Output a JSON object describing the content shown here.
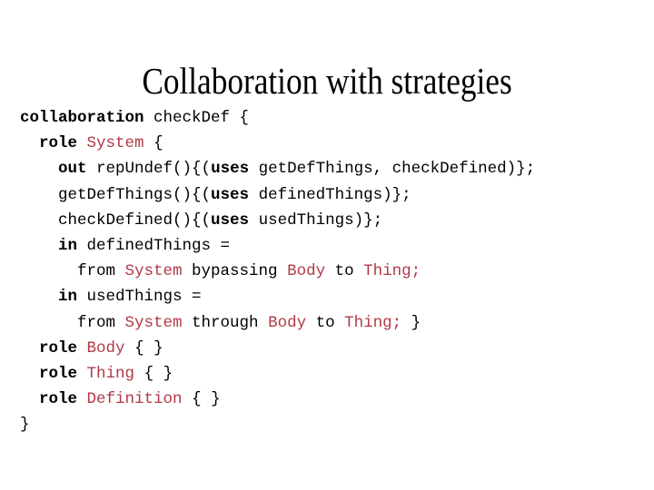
{
  "slide": {
    "title": "Collaboration with strategies",
    "colors": {
      "background": "#ffffff",
      "text": "#000000",
      "role_name": "#b03a48"
    }
  },
  "code": {
    "language": "collaboration-strategy-dsl",
    "lines": [
      {
        "indent": 0,
        "text": "collaboration checkDef {",
        "tokens": [
          {
            "t": "collaboration",
            "style": "kw"
          },
          {
            "t": " ",
            "style": "plain"
          },
          {
            "t": "checkDef {",
            "style": "plain"
          }
        ]
      },
      {
        "indent": 2,
        "text": "  role System {",
        "tokens": [
          {
            "t": "  ",
            "style": "plain"
          },
          {
            "t": "role",
            "style": "kw"
          },
          {
            "t": " ",
            "style": "plain"
          },
          {
            "t": "System",
            "style": "role"
          },
          {
            "t": " {",
            "style": "plain"
          }
        ]
      },
      {
        "indent": 4,
        "text": "    out repUndef(){(uses getDefThings, checkDefined)};",
        "tokens": [
          {
            "t": "    ",
            "style": "plain"
          },
          {
            "t": "out",
            "style": "kw"
          },
          {
            "t": " repUndef(){(",
            "style": "plain"
          },
          {
            "t": "uses",
            "style": "kw"
          },
          {
            "t": " getDefThings, checkDefined)};",
            "style": "plain"
          }
        ]
      },
      {
        "indent": 4,
        "text": "    getDefThings(){(uses definedThings)};",
        "tokens": [
          {
            "t": "    getDefThings(){(",
            "style": "plain"
          },
          {
            "t": "uses",
            "style": "kw"
          },
          {
            "t": " definedThings)};",
            "style": "plain"
          }
        ]
      },
      {
        "indent": 4,
        "text": "    checkDefined(){(uses usedThings)};",
        "tokens": [
          {
            "t": "    checkDefined(){(",
            "style": "plain"
          },
          {
            "t": "uses",
            "style": "kw"
          },
          {
            "t": " usedThings)};",
            "style": "plain"
          }
        ]
      },
      {
        "indent": 4,
        "text": "    in definedThings =",
        "tokens": [
          {
            "t": "    ",
            "style": "plain"
          },
          {
            "t": "in",
            "style": "kw"
          },
          {
            "t": " definedThings =",
            "style": "plain"
          }
        ]
      },
      {
        "indent": 6,
        "text": "      from System bypassing Body to Thing;",
        "tokens": [
          {
            "t": "      from ",
            "style": "plain"
          },
          {
            "t": "System",
            "style": "role"
          },
          {
            "t": " bypassing ",
            "style": "plain"
          },
          {
            "t": "Body",
            "style": "role"
          },
          {
            "t": " to ",
            "style": "plain"
          },
          {
            "t": "Thing;",
            "style": "role"
          }
        ]
      },
      {
        "indent": 4,
        "text": "    in usedThings =",
        "tokens": [
          {
            "t": "    ",
            "style": "plain"
          },
          {
            "t": "in",
            "style": "kw"
          },
          {
            "t": " usedThings =",
            "style": "plain"
          }
        ]
      },
      {
        "indent": 6,
        "text": "      from System through Body to Thing; }",
        "tokens": [
          {
            "t": "      from ",
            "style": "plain"
          },
          {
            "t": "System",
            "style": "role"
          },
          {
            "t": " through ",
            "style": "plain"
          },
          {
            "t": "Body",
            "style": "role"
          },
          {
            "t": " to ",
            "style": "plain"
          },
          {
            "t": "Thing;",
            "style": "role"
          },
          {
            "t": " }",
            "style": "plain"
          }
        ]
      },
      {
        "indent": 2,
        "text": "  role Body { }",
        "tokens": [
          {
            "t": "  ",
            "style": "plain"
          },
          {
            "t": "role",
            "style": "kw"
          },
          {
            "t": " ",
            "style": "plain"
          },
          {
            "t": "Body",
            "style": "role"
          },
          {
            "t": " { }",
            "style": "plain"
          }
        ]
      },
      {
        "indent": 2,
        "text": "  role Thing { }",
        "tokens": [
          {
            "t": "  ",
            "style": "plain"
          },
          {
            "t": "role",
            "style": "kw"
          },
          {
            "t": " ",
            "style": "plain"
          },
          {
            "t": "Thing",
            "style": "role"
          },
          {
            "t": " { }",
            "style": "plain"
          }
        ]
      },
      {
        "indent": 2,
        "text": "  role Definition { }",
        "tokens": [
          {
            "t": "  ",
            "style": "plain"
          },
          {
            "t": "role",
            "style": "kw"
          },
          {
            "t": " ",
            "style": "plain"
          },
          {
            "t": "Definition",
            "style": "role"
          },
          {
            "t": " { }",
            "style": "plain"
          }
        ]
      },
      {
        "indent": 0,
        "text": "}",
        "tokens": [
          {
            "t": "}",
            "style": "plain"
          }
        ]
      }
    ]
  }
}
